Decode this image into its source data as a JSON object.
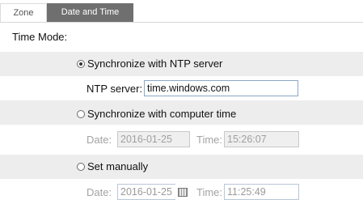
{
  "tabs": [
    {
      "label": "Zone",
      "active": false
    },
    {
      "label": "Date and Time",
      "active": true
    }
  ],
  "time_mode_label": "Time Mode:",
  "options": {
    "ntp": {
      "label": "Synchronize with NTP server",
      "selected": true
    },
    "computer": {
      "label": "Synchronize with computer time",
      "selected": false
    },
    "manual": {
      "label": "Set manually",
      "selected": false
    }
  },
  "ntp": {
    "label": "NTP server:",
    "value": "time.windows.com"
  },
  "computer_time": {
    "date_label": "Date:",
    "date_value": "2016-01-25",
    "time_label": "Time:",
    "time_value": "15:26:07"
  },
  "manual_time": {
    "date_label": "Date:",
    "date_value": "2016-01-25",
    "time_label": "Time:",
    "time_value": "11:25:49"
  },
  "colors": {
    "active_tab": "#6f6f6f",
    "row_shade": "#ededed",
    "field_border": "#8aa9c7"
  }
}
